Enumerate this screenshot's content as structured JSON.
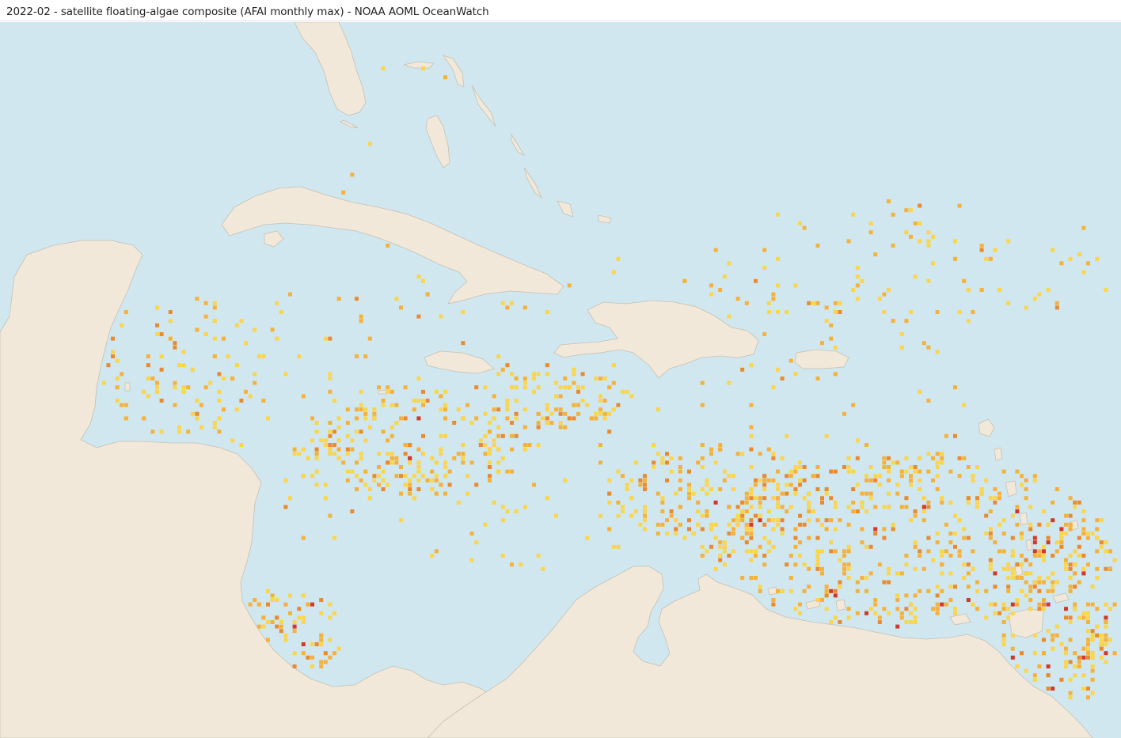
{
  "header": {
    "title": "2022-02 - satellite floating-algae composite (AFAI monthly max) - NOAA AOML OceanWatch"
  },
  "map": {
    "colors": {
      "ocean": "#d0e7ef",
      "land": "#f1e8d9",
      "coast": "#c6c0b3",
      "afai_low": "#fbd54a",
      "afai_mid": "#f5b13a",
      "afai_high": "#ea8a2e",
      "afai_max": "#d2382a"
    }
  }
}
